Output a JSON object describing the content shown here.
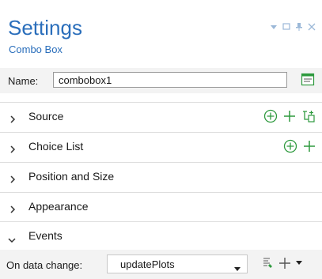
{
  "panel": {
    "title": "Settings",
    "subtitle": "Combo Box"
  },
  "window_controls": [
    "pin-dropdown-icon",
    "restore-icon",
    "pin-icon",
    "close-icon"
  ],
  "name_field": {
    "label": "Name:",
    "value": "combobox1"
  },
  "sections": [
    {
      "label": "Source",
      "expanded": false,
      "icons": [
        "add-circle-icon",
        "plus-icon",
        "tree-add-icon"
      ]
    },
    {
      "label": "Choice List",
      "expanded": false,
      "icons": [
        "add-circle-icon",
        "plus-icon"
      ]
    },
    {
      "label": "Position and Size",
      "expanded": false,
      "icons": []
    },
    {
      "label": "Appearance",
      "expanded": false,
      "icons": []
    },
    {
      "label": "Events",
      "expanded": true,
      "icons": []
    }
  ],
  "events": {
    "label": "On data change:",
    "selected": "updatePlots"
  },
  "colors": {
    "accent": "#2a6ebb",
    "green_icon": "#2f9a3f",
    "row_bg": "#f3f3f3"
  }
}
